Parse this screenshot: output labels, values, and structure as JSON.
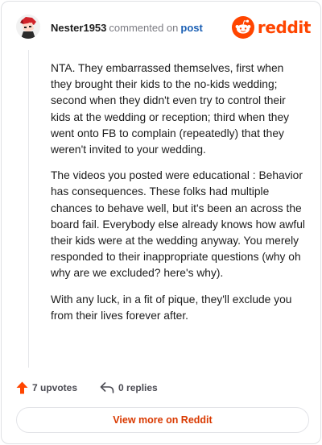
{
  "header": {
    "username": "Nester1953",
    "verb": "commented on",
    "post_link": "post",
    "brand_word": "reddit",
    "brand_color": "#ff4500"
  },
  "comment": {
    "paragraphs": [
      "NTA. They embarrassed themselves, first when they brought their kids to the no-kids wedding; second when they didn't even try to control their kids at the wedding or reception; third when they went onto FB to complain (repeatedly) that they weren't invited to your wedding.",
      "The videos you posted were educational : Behavior has consequences. These folks had multiple chances to behave well, but it's been an across the board fail. Everybody else already knows how awful their kids were at the wedding anyway. You merely responded to their inappropriate questions (why oh why are we excluded? here's why).",
      "With any luck, in a fit of pique, they'll exclude you from their lives forever after."
    ]
  },
  "actions": {
    "upvotes_label": "7 upvotes",
    "replies_label": "0 replies",
    "upvote_icon": "upvote-arrow-icon",
    "reply_icon": "reply-arrow-icon"
  },
  "footer": {
    "view_more_label": "View more on Reddit"
  }
}
